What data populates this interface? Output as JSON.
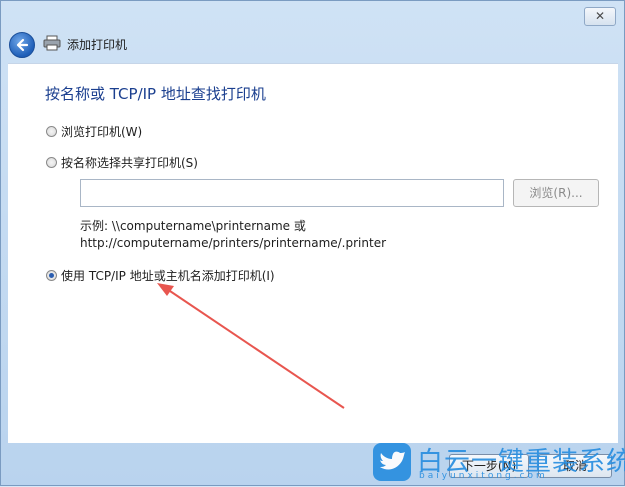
{
  "window": {
    "close_label": "✕",
    "title": "添加打印机"
  },
  "page": {
    "heading": "按名称或 TCP/IP 地址查找打印机",
    "options": [
      {
        "label": "浏览打印机(W)",
        "checked": false
      },
      {
        "label": "按名称选择共享打印机(S)",
        "checked": false
      },
      {
        "label": "使用 TCP/IP 地址或主机名添加打印机(I)",
        "checked": true
      }
    ],
    "share_input": {
      "value": "",
      "placeholder": ""
    },
    "browse_label": "浏览(R)...",
    "example_line1": "示例: \\\\computername\\printername 或",
    "example_line2": "http://computername/printers/printername/.printer"
  },
  "footer": {
    "next_label": "下一步(N)",
    "cancel_label": "取消"
  },
  "watermark": {
    "text": "白云一键重装系统",
    "url": "baiyunxitong.com"
  },
  "colors": {
    "heading": "#1b3f8f",
    "arrow": "#e8564f",
    "watermark": "#2a8fe0"
  }
}
